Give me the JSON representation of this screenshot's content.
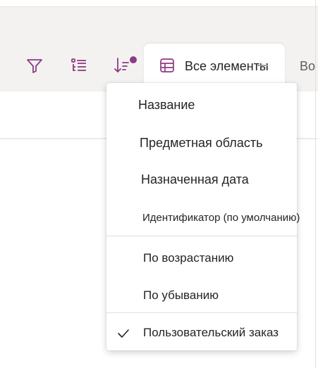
{
  "toolbar": {
    "filter_icon": "filter-icon",
    "group_icon": "group-by-icon",
    "sort_icon": "sort-icon",
    "accent_color": "#8e3a82"
  },
  "view_selector": {
    "label": "Все элементы",
    "icon": "grid-view-icon"
  },
  "next_tab": {
    "label": "Во"
  },
  "sort_menu": {
    "fields": [
      {
        "label": "Название"
      },
      {
        "label": "Предметная область"
      },
      {
        "label": "Назначенная дата"
      },
      {
        "label": "Идентификатор (по умолчанию)"
      }
    ],
    "order": [
      {
        "label": "По возрастанию"
      },
      {
        "label": "По убыванию"
      }
    ],
    "custom": {
      "label": "Пользовательский заказ",
      "checked": true
    }
  }
}
